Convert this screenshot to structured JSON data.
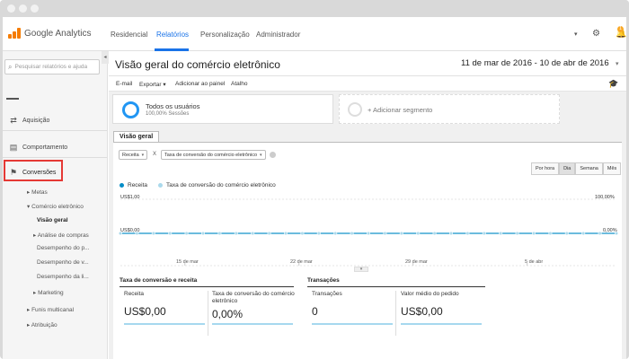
{
  "app": {
    "name": "Google Analytics"
  },
  "topnav": {
    "links": [
      "Residencial",
      "Relatórios",
      "Personalização",
      "Administrador"
    ],
    "active_index": 1,
    "notification_count": "1"
  },
  "sidebar": {
    "search_placeholder": "Pesquisar relatórios e ajuda",
    "items": [
      {
        "label": "Aquisição",
        "icon": "arrows-icon"
      },
      {
        "label": "Comportamento",
        "icon": "browser-window-icon"
      },
      {
        "label": "Conversões",
        "icon": "flag-icon"
      }
    ],
    "sub_items": [
      {
        "label": "Metas",
        "arrow": "▸"
      },
      {
        "label": "Comércio eletrônico",
        "arrow": "▾"
      },
      {
        "label": "Visão geral",
        "arrow": ""
      },
      {
        "label": "Análise de compras",
        "arrow": "▸"
      },
      {
        "label": "Desempenho do p...",
        "arrow": ""
      },
      {
        "label": "Desempenho de v...",
        "arrow": ""
      },
      {
        "label": "Desempenho da li...",
        "arrow": ""
      },
      {
        "label": "Marketing",
        "arrow": "▸"
      },
      {
        "label": "Funis multicanal",
        "arrow": "▸"
      },
      {
        "label": "Atribuição",
        "arrow": "▸"
      }
    ]
  },
  "header": {
    "title": "Visão geral do comércio eletrônico",
    "date_range": "11 de mar de 2016 - 10 de abr de 2016"
  },
  "toolbar": {
    "items": [
      "E-mail",
      "Exportar ▾",
      "Adicionar ao painel",
      "Atalho"
    ]
  },
  "segments": {
    "active": {
      "title": "Todos os usuários",
      "subtitle": "100,00% Sessões"
    },
    "add_label": "+ Adicionar segmento"
  },
  "report": {
    "tab_label": "Visão geral",
    "metric_select": "Receita",
    "vs_label": "X",
    "compare_select": "Taxa de conversão do comércio eletrônico",
    "period_buttons": [
      "Por hora",
      "Dia",
      "Semana",
      "Mês"
    ],
    "period_active_index": 1
  },
  "chart_data": {
    "type": "line",
    "series": [
      {
        "name": "Receita",
        "color": "#058dc7"
      },
      {
        "name": "Taxa de conversão do comércio eletrônico",
        "color": "#aad9ec"
      }
    ],
    "left_axis": {
      "top": "US$1,00",
      "bottom": "US$0,00"
    },
    "right_axis": {
      "top": "100,00%",
      "bottom": "0,00%"
    },
    "x_ticks": [
      "15 de mar",
      "22 de mar",
      "29 de mar",
      "5 de abr"
    ],
    "points": 31,
    "value": 0
  },
  "metrics": {
    "group1_title": "Taxa de conversão e receita",
    "group2_title": "Transações",
    "items": [
      {
        "label": "Receita",
        "value": "US$0,00"
      },
      {
        "label": "Taxa de conversão do comércio eletrônico",
        "value": "0,00%"
      },
      {
        "label": "Transações",
        "value": "0"
      },
      {
        "label": "Valor médio do pedido",
        "value": "US$0,00"
      }
    ]
  }
}
